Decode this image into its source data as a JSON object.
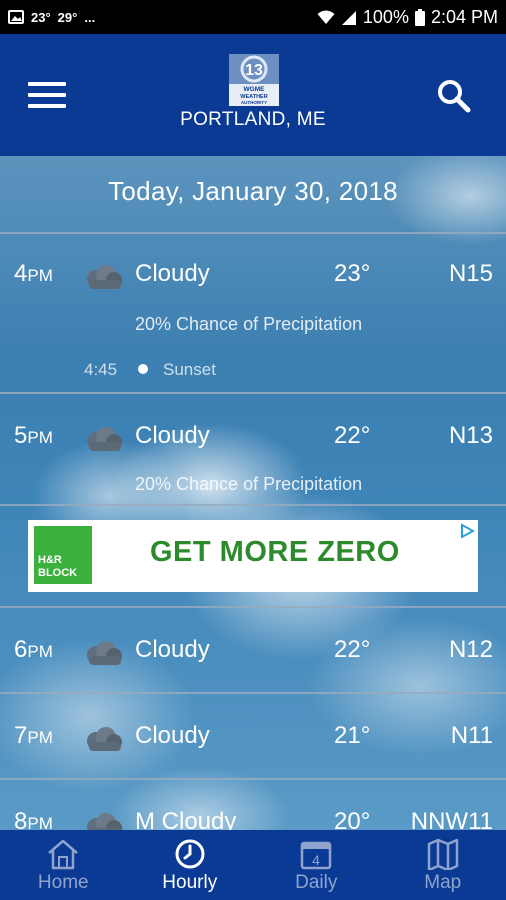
{
  "status_bar": {
    "temp_low": "23°",
    "temp_high": "29°",
    "more": "...",
    "battery": "100%",
    "time": "2:04 PM"
  },
  "header": {
    "logo_icon": "wgme-logo-icon",
    "logo_lines": [
      "WGME",
      "WEATHER",
      "AUTHORITY"
    ],
    "location": "PORTLAND, ME"
  },
  "date_title": "Today, January 30, 2018",
  "hours": [
    {
      "hour": "4",
      "suffix": "PM",
      "condition": "Cloudy",
      "temp": "23°",
      "wind": "N15",
      "precip": "20% Chance of Precipitation",
      "sunset_time": "4:45",
      "sunset_label": "Sunset"
    },
    {
      "hour": "5",
      "suffix": "PM",
      "condition": "Cloudy",
      "temp": "22°",
      "wind": "N13",
      "precip": "20% Chance of Precipitation"
    },
    {
      "hour": "6",
      "suffix": "PM",
      "condition": "Cloudy",
      "temp": "22°",
      "wind": "N12"
    },
    {
      "hour": "7",
      "suffix": "PM",
      "condition": "Cloudy",
      "temp": "21°",
      "wind": "N11"
    },
    {
      "hour": "8",
      "suffix": "PM",
      "condition": "M Cloudy",
      "temp": "20°",
      "wind": "NNW11"
    }
  ],
  "ad": {
    "brand_line1": "H&R",
    "brand_line2": "BLOCK",
    "text": "GET MORE ZERO"
  },
  "nav": {
    "home": "Home",
    "hourly": "Hourly",
    "daily": "Daily",
    "daily_day": "4",
    "map": "Map",
    "active": "hourly"
  },
  "colors": {
    "header_bg": "#0b3a94",
    "nav_inactive": "#8fa3cc",
    "ad_green": "#2d8a2d"
  }
}
